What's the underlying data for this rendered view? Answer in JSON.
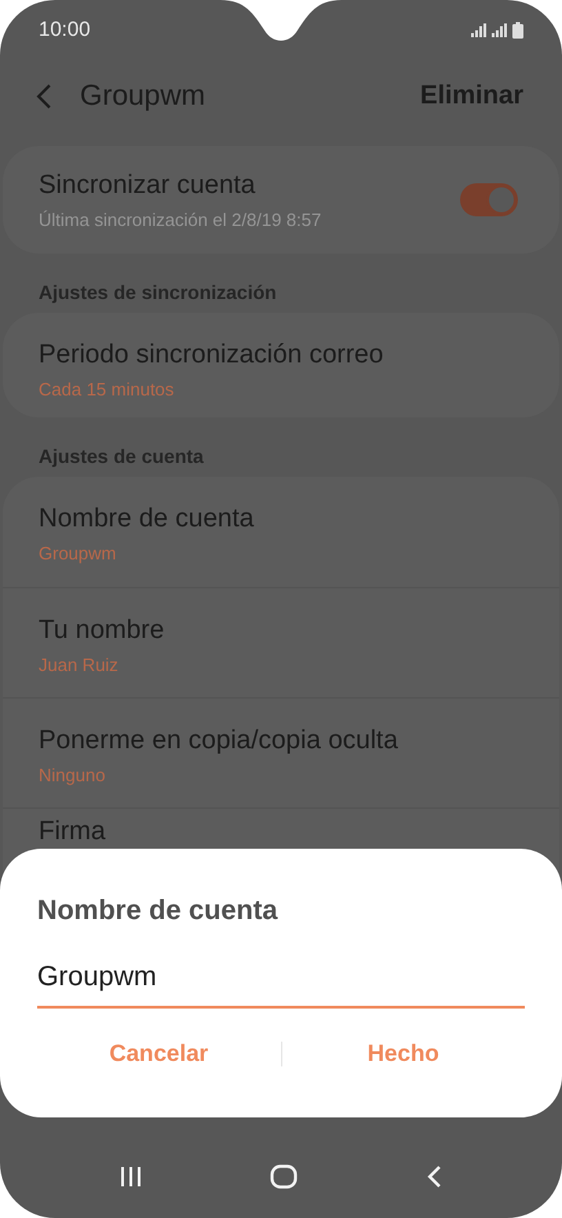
{
  "status_bar": {
    "time": "10:00"
  },
  "header": {
    "title": "Groupwm",
    "action": "Eliminar"
  },
  "sync": {
    "title": "Sincronizar cuenta",
    "subtitle": "Última sincronización el 2/8/19  8:57",
    "on": true
  },
  "sections": [
    {
      "heading": "Ajustes de sincronización",
      "items": [
        {
          "title": "Periodo sincronización correo",
          "value": "Cada 15 minutos"
        }
      ]
    },
    {
      "heading": "Ajustes de cuenta",
      "items": [
        {
          "title": "Nombre de cuenta",
          "value": "Groupwm"
        },
        {
          "title": "Tu nombre",
          "value": "Juan Ruiz"
        },
        {
          "title": "Ponerme en copia/copia oculta",
          "value": "Ninguno"
        },
        {
          "title": "Firma"
        }
      ]
    }
  ],
  "dialog": {
    "title": "Nombre de cuenta",
    "value": "Groupwm",
    "buttons": [
      "Cancelar",
      "Hecho"
    ]
  }
}
